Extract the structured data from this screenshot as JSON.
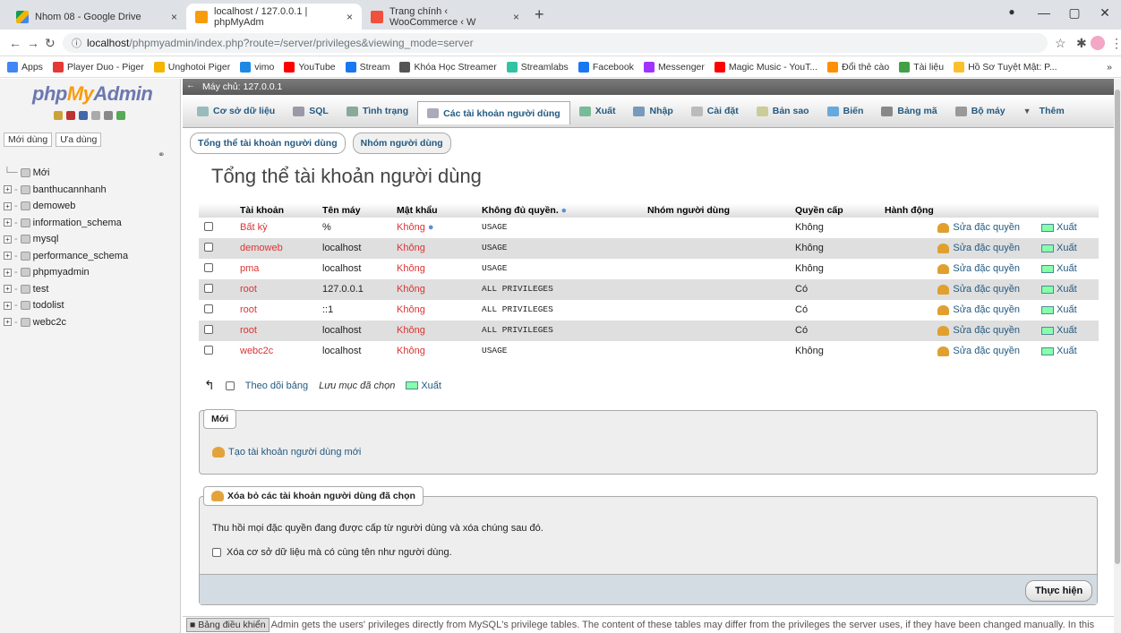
{
  "browser": {
    "tabs": [
      {
        "title": "Nhom 08 - Google Drive",
        "icon": "google-drive-icon",
        "close": "×"
      },
      {
        "title": "localhost / 127.0.0.1 | phpMyAdm",
        "icon": "phpmyadmin-icon",
        "close": "×"
      },
      {
        "title": "Trang chính ‹ WooCommerce ‹ W",
        "icon": "woocommerce-icon",
        "close": "×"
      }
    ],
    "new_tab": "+",
    "url_host": "localhost",
    "url_path": "/phpmyadmin/index.php?route=/server/privileges&viewing_mode=server",
    "bookmarks": [
      {
        "label": "Apps",
        "color": "#4285f4"
      },
      {
        "label": "Player Duo - Piger",
        "color": "#e53935"
      },
      {
        "label": "Unghotoi Piger",
        "color": "#f4b400"
      },
      {
        "label": "vimo",
        "color": "#1e88e5"
      },
      {
        "label": "YouTube",
        "color": "#ff0000"
      },
      {
        "label": "Stream",
        "color": "#1877f2"
      },
      {
        "label": "Khóa Học Streamer",
        "color": "#555555"
      },
      {
        "label": "Streamlabs",
        "color": "#31c3a2"
      },
      {
        "label": "Facebook",
        "color": "#1877f2"
      },
      {
        "label": "Messenger",
        "color": "#a033ff"
      },
      {
        "label": "Magic Music - YouT...",
        "color": "#ff0000"
      },
      {
        "label": "Đổi thẻ cào",
        "color": "#ff8f00"
      },
      {
        "label": "Tài liệu",
        "color": "#43a047"
      },
      {
        "label": "Hồ Sơ Tuyệt Mật: P...",
        "color": "#fbc02d"
      }
    ],
    "more": "»"
  },
  "nav": {
    "logo_php": "php",
    "logo_my": "My",
    "logo_admin": "Admin",
    "tab_recent": "Mới dùng",
    "tab_fav": "Ưa dùng",
    "new_label": "Mới",
    "databases": [
      "banthucannhanh",
      "demoweb",
      "information_schema",
      "mysql",
      "performance_schema",
      "phpmyadmin",
      "test",
      "todolist",
      "webc2c"
    ]
  },
  "main": {
    "server_title": "Máy chủ: 127.0.0.1",
    "menu": [
      {
        "label": "Cơ sở dữ liệu",
        "color": "#9bb"
      },
      {
        "label": "SQL",
        "color": "#99a"
      },
      {
        "label": "Tình trạng",
        "color": "#8a9"
      },
      {
        "label": "Các tài khoản người dùng",
        "color": "#aab",
        "active": true
      },
      {
        "label": "Xuất",
        "color": "#7b9"
      },
      {
        "label": "Nhập",
        "color": "#79b"
      },
      {
        "label": "Cài đặt",
        "color": "#bbb"
      },
      {
        "label": "Bản sao",
        "color": "#cc9"
      },
      {
        "label": "Biến",
        "color": "#6ad"
      },
      {
        "label": "Bảng mã",
        "color": "#888"
      },
      {
        "label": "Bộ máy",
        "color": "#999"
      },
      {
        "label": "Thêm",
        "color": "#555"
      }
    ],
    "subtab_overview": "Tổng thể tài khoản người dùng",
    "subtab_groups": "Nhóm người dùng",
    "heading": "Tổng thể tài khoản người dùng",
    "columns": {
      "account": "Tài khoản",
      "host": "Tên máy",
      "password": "Mật khẩu",
      "privileges": "Không đủ quyền.",
      "group": "Nhóm người dùng",
      "grant": "Quyền cấp",
      "action": "Hành động"
    },
    "rows": [
      {
        "user": "Bất kỳ",
        "host": "%",
        "password": "Không",
        "priv": "USAGE",
        "grant": "Không",
        "edit": "Sửa đặc quyền",
        "export": "Xuất"
      },
      {
        "user": "demoweb",
        "host": "localhost",
        "password": "Không",
        "priv": "USAGE",
        "grant": "Không",
        "edit": "Sửa đặc quyền",
        "export": "Xuất"
      },
      {
        "user": "pma",
        "host": "localhost",
        "password": "Không",
        "priv": "USAGE",
        "grant": "Không",
        "edit": "Sửa đặc quyền",
        "export": "Xuất"
      },
      {
        "user": "root",
        "host": "127.0.0.1",
        "password": "Không",
        "priv": "ALL PRIVILEGES",
        "grant": "Có",
        "edit": "Sửa đặc quyền",
        "export": "Xuất"
      },
      {
        "user": "root",
        "host": "::1",
        "password": "Không",
        "priv": "ALL PRIVILEGES",
        "grant": "Có",
        "edit": "Sửa đặc quyền",
        "export": "Xuất"
      },
      {
        "user": "root",
        "host": "localhost",
        "password": "Không",
        "priv": "ALL PRIVILEGES",
        "grant": "Có",
        "edit": "Sửa đặc quyền",
        "export": "Xuất"
      },
      {
        "user": "webc2c",
        "host": "localhost",
        "password": "Không",
        "priv": "USAGE",
        "grant": "Không",
        "edit": "Sửa đặc quyền",
        "export": "Xuất"
      }
    ],
    "check_all": "Theo dõi bảng",
    "with_selected": "Lưu mục đã chọn",
    "export_selected": "Xuất",
    "new_legend": "Mới",
    "create_user": "Tạo tài khoản người dùng mới",
    "delete_legend": "Xóa bỏ các tài khoản người dùng đã chọn",
    "revoke_text": "Thu hồi mọi đặc quyền đang được cấp từ người dùng và xóa chúng sau đó.",
    "drop_db_label": "Xóa cơ sở dữ liệu mà có cùng tên như người dùng.",
    "go_button": "Thực hiện",
    "console_label": "Bảng điều khiển",
    "console_text": "Admin gets the users' privileges directly from MySQL's privilege tables. The content of these tables may differ from the privileges the server uses, if they have been changed manually. In this"
  }
}
